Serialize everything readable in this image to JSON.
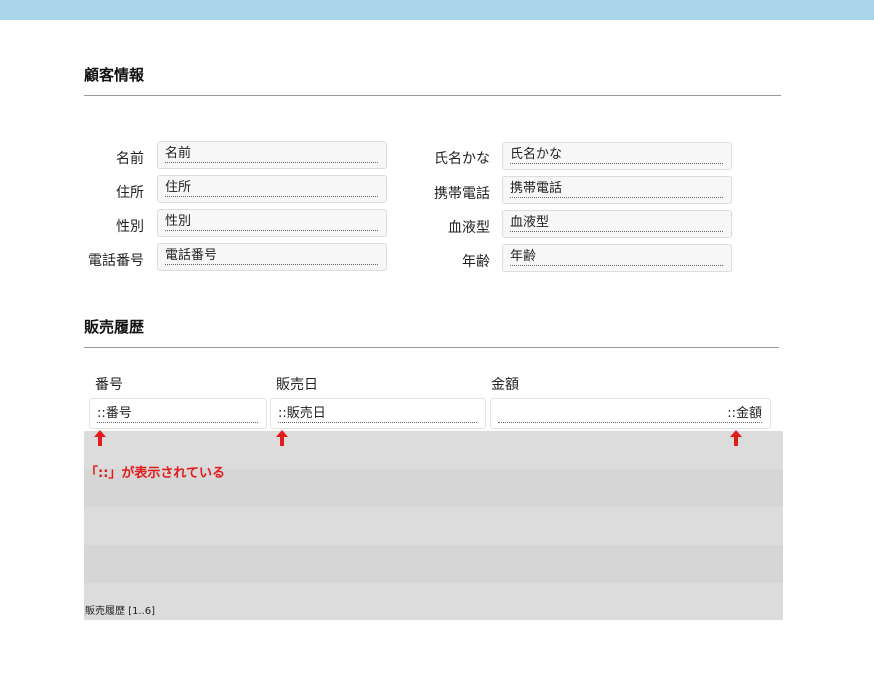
{
  "customer": {
    "title": "顧客情報",
    "fields": [
      {
        "label": "名前",
        "value": "名前"
      },
      {
        "label": "住所",
        "value": "住所"
      },
      {
        "label": "性別",
        "value": "性別"
      },
      {
        "label": "電話番号",
        "value": "電話番号"
      },
      {
        "label": "氏名かな",
        "value": "氏名かな"
      },
      {
        "label": "携帯電話",
        "value": "携帯電話"
      },
      {
        "label": "血液型",
        "value": "血液型"
      },
      {
        "label": "年齢",
        "value": "年齢"
      }
    ]
  },
  "sales": {
    "title": "販売履歴",
    "columns": [
      "番号",
      "販売日",
      "金額"
    ],
    "row": [
      "::番号",
      "::販売日",
      "::金額"
    ],
    "note": "「::」が表示されている",
    "footer": "販売履歴 [1..6]"
  },
  "colors": {
    "accent_bar": "#a9d4ea",
    "note": "#e41b1b",
    "arrow": "#e41b1b"
  },
  "icons": [
    "arrow-up-icon",
    "arrow-up-icon",
    "arrow-up-icon"
  ]
}
